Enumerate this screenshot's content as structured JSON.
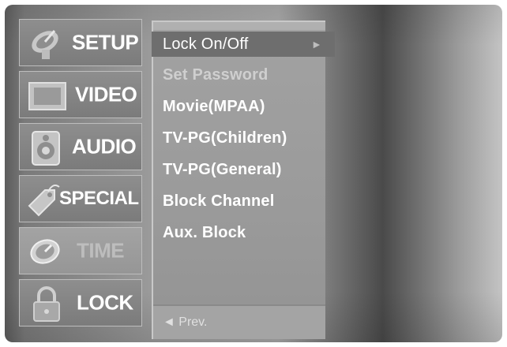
{
  "tabs": [
    {
      "id": "setup",
      "label": "SETUP",
      "icon": "satellite-dish-icon",
      "active": false
    },
    {
      "id": "video",
      "label": "VIDEO",
      "icon": "screen-icon",
      "active": false
    },
    {
      "id": "audio",
      "label": "AUDIO",
      "icon": "speaker-icon",
      "active": false
    },
    {
      "id": "special",
      "label": "SPECIAL",
      "icon": "tag-icon",
      "active": false
    },
    {
      "id": "time",
      "label": "TIME",
      "icon": "clock-icon",
      "active": true
    },
    {
      "id": "lock",
      "label": "LOCK",
      "icon": "padlock-icon",
      "active": false
    }
  ],
  "menu": {
    "items": [
      {
        "label": "Lock On/Off",
        "state": "selected"
      },
      {
        "label": "Set Password",
        "state": "dim"
      },
      {
        "label": "Movie(MPAA)",
        "state": "normal"
      },
      {
        "label": "TV-PG(Children)",
        "state": "normal"
      },
      {
        "label": "TV-PG(General)",
        "state": "normal"
      },
      {
        "label": "Block Channel",
        "state": "normal"
      },
      {
        "label": "Aux. Block",
        "state": "normal"
      }
    ],
    "selected_arrow": "►",
    "prev_label": "◄ Prev."
  }
}
